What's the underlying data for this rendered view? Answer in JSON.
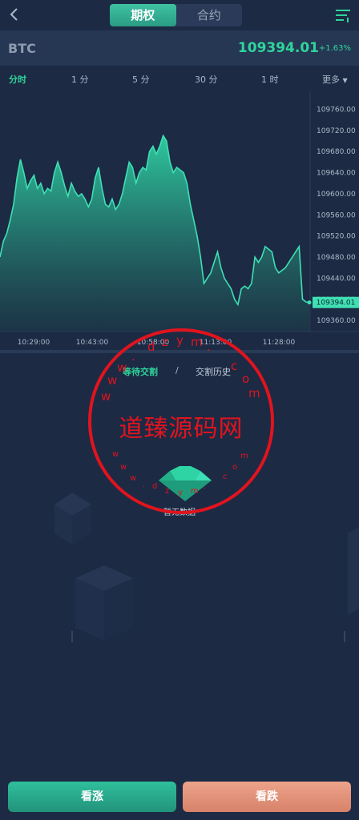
{
  "header": {
    "tabs": [
      {
        "label": "期权",
        "active": true
      },
      {
        "label": "合约",
        "active": false
      }
    ]
  },
  "ticker": {
    "symbol": "BTC",
    "price": "109394.01",
    "change": "+1.63%"
  },
  "intervals": [
    {
      "label": "分时",
      "active": true
    },
    {
      "label": "1 分"
    },
    {
      "label": "5 分"
    },
    {
      "label": "30 分"
    },
    {
      "label": "1 时"
    },
    {
      "label": "更多"
    }
  ],
  "chart_data": {
    "type": "area",
    "y_ticks": [
      "109760.00",
      "109720.00",
      "109680.00",
      "109640.00",
      "109600.00",
      "109560.00",
      "109520.00",
      "109480.00",
      "109440.00",
      "109400.00",
      "109360.00"
    ],
    "x_ticks": [
      "10:29:00",
      "10:43:00",
      "10:58:00",
      "11:13:00",
      "11:28:00"
    ],
    "ylim": [
      109345,
      109785
    ],
    "current_price_label": "109394.01",
    "values": [
      109480,
      109510,
      109525,
      109550,
      109580,
      109630,
      109665,
      109640,
      109610,
      109625,
      109635,
      109610,
      109620,
      109600,
      109610,
      109605,
      109640,
      109660,
      109640,
      109615,
      109595,
      109620,
      109605,
      109595,
      109600,
      109590,
      109575,
      109590,
      109630,
      109650,
      109610,
      109580,
      109575,
      109590,
      109570,
      109580,
      109600,
      109630,
      109660,
      109650,
      109620,
      109640,
      109650,
      109645,
      109680,
      109690,
      109675,
      109690,
      109710,
      109700,
      109660,
      109640,
      109650,
      109645,
      109640,
      109620,
      109580,
      109550,
      109520,
      109480,
      109430,
      109440,
      109450,
      109470,
      109490,
      109460,
      109440,
      109430,
      109420,
      109400,
      109390,
      109420,
      109425,
      109420,
      109430,
      109480,
      109470,
      109480,
      109500,
      109495,
      109490,
      109460,
      109450,
      109455,
      109460,
      109470,
      109480,
      109490,
      109500,
      109400,
      109395,
      109394
    ]
  },
  "order_tabs": [
    {
      "label": "等待交割",
      "active": true
    },
    {
      "label": "交割历史",
      "active": false
    }
  ],
  "order_sep": "/",
  "empty_text": "暂无数据",
  "watermark": {
    "main": "道臻源码网",
    "top": [
      "w",
      "w",
      "w",
      ".",
      "d",
      "z",
      "y",
      "m",
      ".",
      "c",
      "o",
      "m"
    ],
    "bottom": [
      "w",
      "w",
      "w",
      ".",
      "d",
      "z",
      "y",
      "m",
      ".",
      "c",
      "o",
      "m"
    ]
  },
  "actions": {
    "up_label": "看涨",
    "down_label": "看跌"
  },
  "colors": {
    "accent": "#2fd49a",
    "background": "#1c2a44",
    "up": "#2fbf9c",
    "down": "#e8977d",
    "watermark": "#e0141e"
  }
}
